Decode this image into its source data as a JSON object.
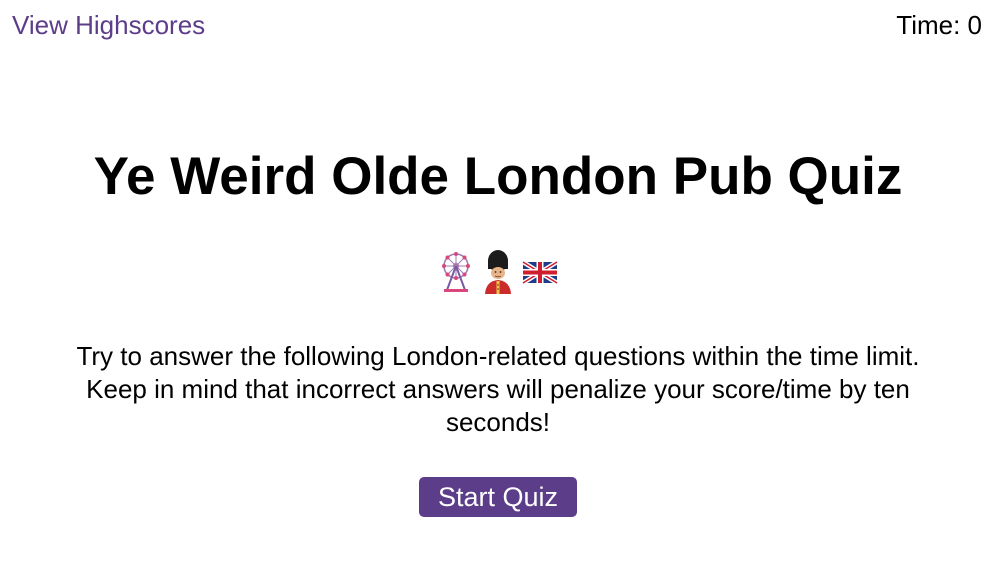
{
  "header": {
    "highscores_link": "View Highscores",
    "timer_label": "Time: 0"
  },
  "main": {
    "title": "Ye Weird Olde London Pub Quiz",
    "emojis": [
      "ferris-wheel-icon",
      "royal-guard-icon",
      "union-jack-flag-icon"
    ],
    "description": "Try to answer the following London-related questions within the time limit. Keep in mind that incorrect answers will penalize your score/time by ten seconds!",
    "start_button": "Start Quiz"
  },
  "colors": {
    "accent": "#5b3d8a",
    "button_text": "#ffffff",
    "text": "#000000",
    "background": "#ffffff"
  }
}
